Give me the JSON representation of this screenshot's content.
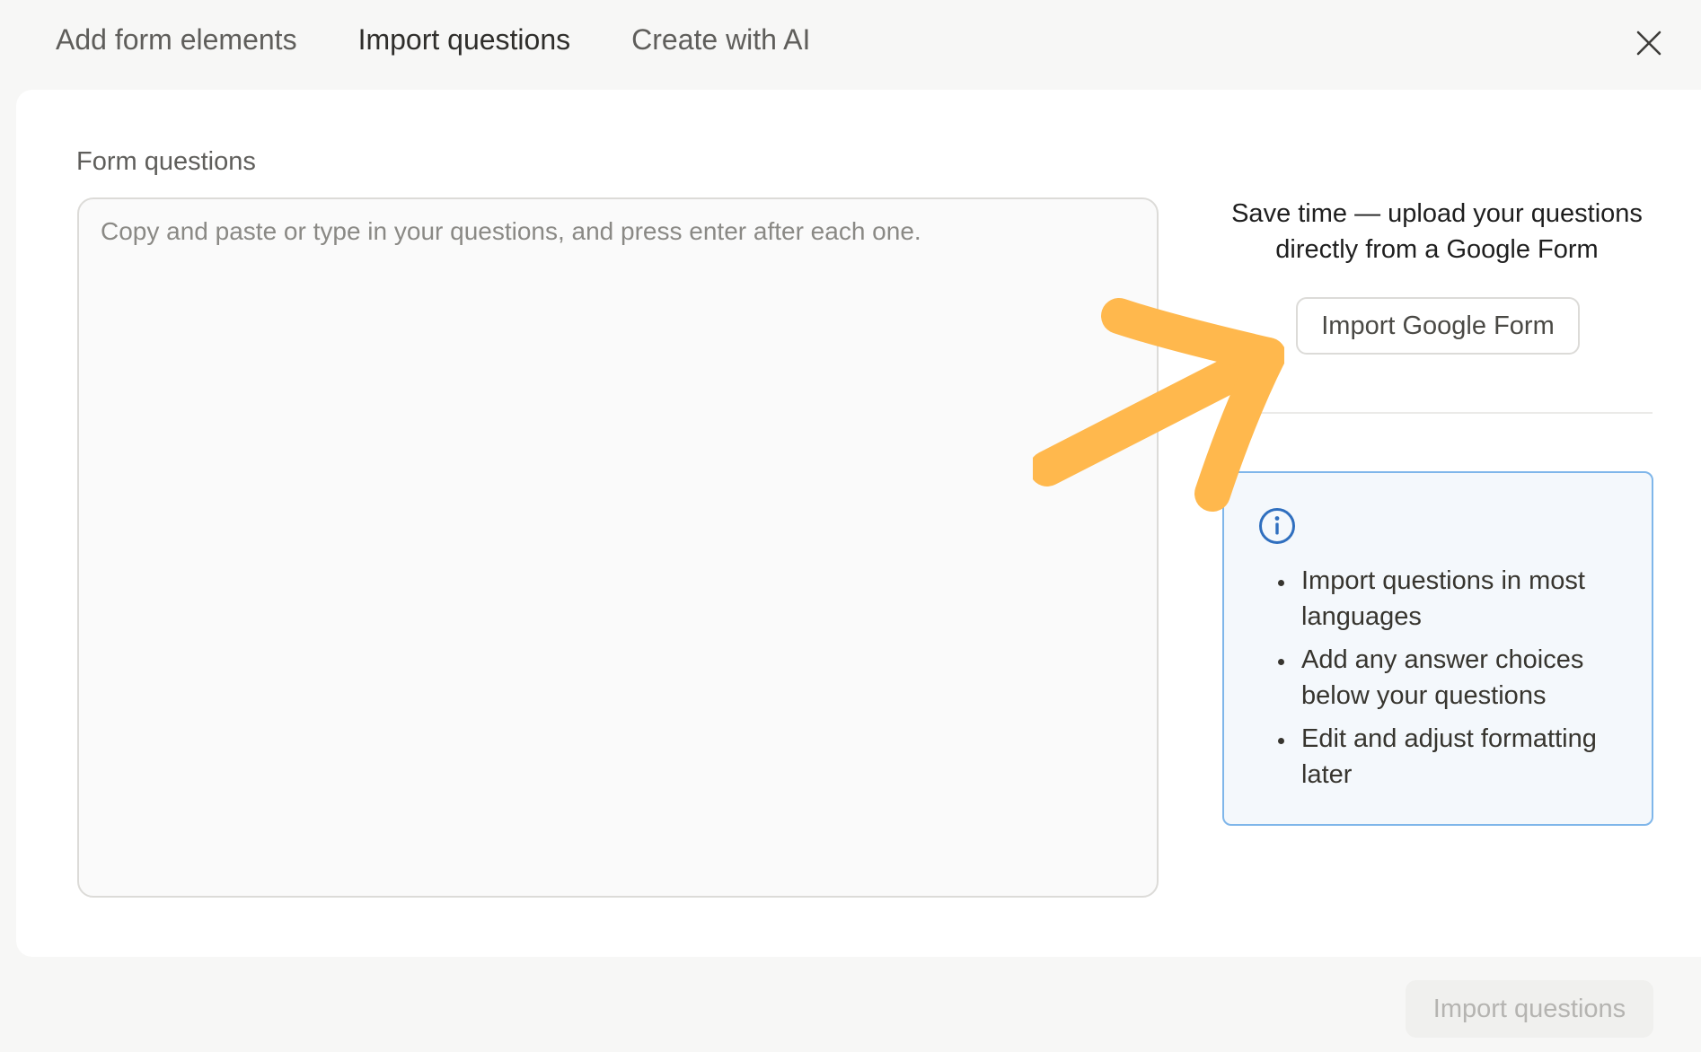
{
  "tabs": [
    {
      "label": "Add form elements",
      "active": false
    },
    {
      "label": "Import questions",
      "active": true
    },
    {
      "label": "Create with AI",
      "active": false
    }
  ],
  "close_icon": "close-icon",
  "form": {
    "label": "Form questions",
    "placeholder": "Copy and paste or type in your questions, and press enter after each one.",
    "value": ""
  },
  "promo": {
    "text_line1": "Save time — upload your questions",
    "text_line2": "directly from a Google Form",
    "button_label": "Import Google Form"
  },
  "info": {
    "icon": "info-icon",
    "items": [
      "Import questions in most languages",
      "Add any answer choices below your questions",
      "Edit and adjust formatting later"
    ]
  },
  "footer": {
    "import_button_label": "Import questions",
    "import_button_disabled": true
  },
  "colors": {
    "arrow": "#ffb84d",
    "info_border": "#7fb6ea",
    "info_icon": "#2f6fbf"
  }
}
